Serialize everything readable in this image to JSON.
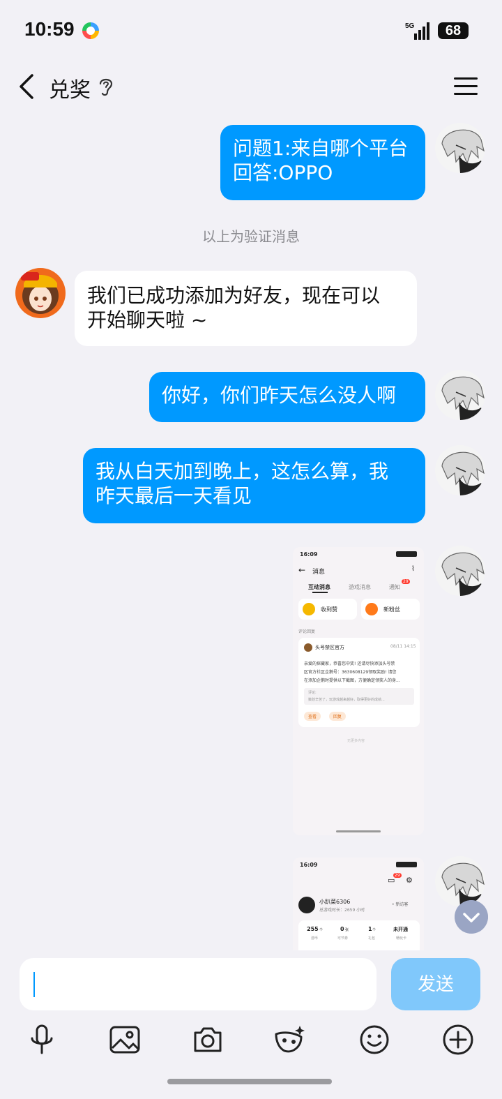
{
  "status_bar": {
    "time": "10:59",
    "network": "5G",
    "battery": "68"
  },
  "header": {
    "title": "兑奖"
  },
  "messages": {
    "m1_line1": "问题1:来自哪个平台",
    "m1_line2": "回答:OPPO",
    "system_note": "以上为验证消息",
    "m2_line1": "我们已成功添加为好友，现在可以",
    "m2_line2": "开始聊天啦 ~",
    "m3": "你好，你们昨天怎么没人啊",
    "m4_line1": "我从白天加到晚上，这怎么算，我",
    "m4_line2": "昨天最后一天看见"
  },
  "shot1": {
    "time": "16:09",
    "title": "消息",
    "tabs": [
      "互动消息",
      "游戏消息",
      "通知"
    ],
    "badge": "29",
    "chip_like": "收到赞",
    "chip_fans": "新粉丝",
    "section": "评论回复",
    "sender": "头号禁区官方",
    "date": "08/11 14:15",
    "body_l1": "亲爱的探藏家，恭喜您中奖! 还请尽快添加头号禁",
    "body_l2": "区官方社区企鹅号：3630608129领取奖励! 请您",
    "body_l3": "在添加企鹅时提供以下截图，方便确定领奖人的身...",
    "quote_label": "评论:",
    "quote_text": "策划辛苦了，玩游戏越来越好，取得更好的成绩...",
    "btn_view": "查看",
    "btn_reply": "回复",
    "more": "无更多内容"
  },
  "shot2": {
    "time": "16:09",
    "badge": "29",
    "username": "小趴菜6306",
    "playtime": "总游戏时长：2659 小时",
    "visitors": "• 新访客",
    "stats": [
      {
        "num": "255",
        "unit": "个",
        "label": "游币"
      },
      {
        "num": "0",
        "unit": "张",
        "label": "可节券"
      },
      {
        "num": "1",
        "unit": "个",
        "label": "礼包"
      },
      {
        "num": "未开通",
        "unit": "",
        "label": "畅玩卡"
      }
    ]
  },
  "composer": {
    "send_label": "发送"
  },
  "colors": {
    "bubble_blue": "#0099ff",
    "send_disabled": "#80c8fb",
    "background": "#f2f1f6"
  }
}
